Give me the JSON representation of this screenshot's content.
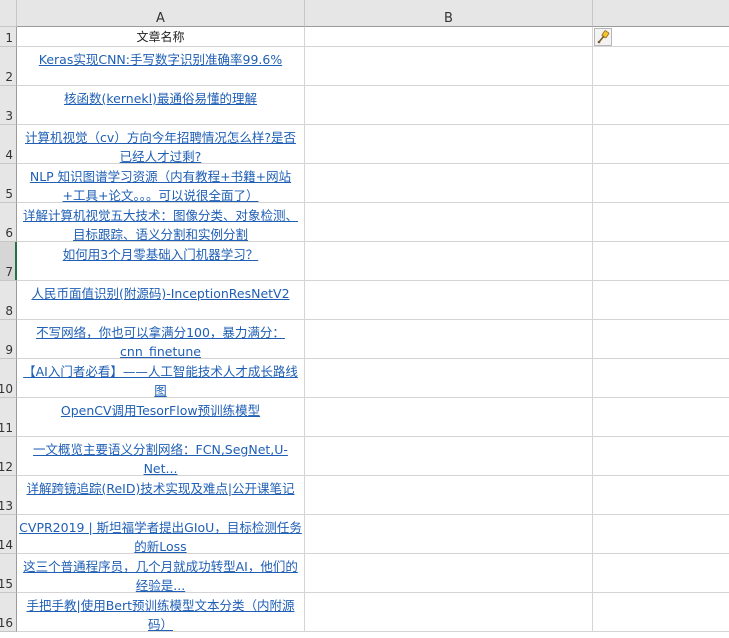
{
  "columns": {
    "a": "A",
    "b": "B"
  },
  "header_row": {
    "number": "1",
    "a": "文章名称"
  },
  "rows": [
    {
      "number": "2",
      "title": "Keras实现CNN:手写数字识别准确率99.6%"
    },
    {
      "number": "3",
      "title": "核函数(kernekl)最通俗易懂的理解"
    },
    {
      "number": "4",
      "title": "计算机视觉（cv）方向今年招聘情况怎么样?是否已经人才过剩?"
    },
    {
      "number": "5",
      "title": "NLP 知识图谱学习资源（内有教程+书籍+网站+工具+论文。。。可以说很全面了）"
    },
    {
      "number": "6",
      "title": "详解计算机视觉五大技术：图像分类、对象检测、目标跟踪、语义分割和实例分割"
    },
    {
      "number": "7",
      "title": "如何用3个月零基础入门机器学习？"
    },
    {
      "number": "8",
      "title": "人民币面值识别(附源码)-InceptionResNetV2"
    },
    {
      "number": "9",
      "title": "不写网络，你也可以拿满分100，暴力满分：cnn_finetune"
    },
    {
      "number": "10",
      "title": "【AI入门者必看】——人工智能技术人才成长路线图"
    },
    {
      "number": "11",
      "title": "OpenCV调用TesorFlow预训练模型"
    },
    {
      "number": "12",
      "title": "一文概览主要语义分割网络：FCN,SegNet,U-Net..."
    },
    {
      "number": "13",
      "title": "详解跨镜追踪(ReID)技术实现及难点|公开课笔记"
    },
    {
      "number": "14",
      "title": "CVPR2019 | 斯坦福学者提出GIoU，目标检测任务的新Loss"
    },
    {
      "number": "15",
      "title": "这三个普通程序员，几个月就成功转型AI，他们的经验是..."
    },
    {
      "number": "16",
      "title": "手把手教|使用Bert预训练模型文本分类（内附源码）"
    }
  ],
  "icons": {
    "format_painter": "paintbrush-icon"
  },
  "colors": {
    "link": "#1f5fb5",
    "selection": "#217346"
  }
}
